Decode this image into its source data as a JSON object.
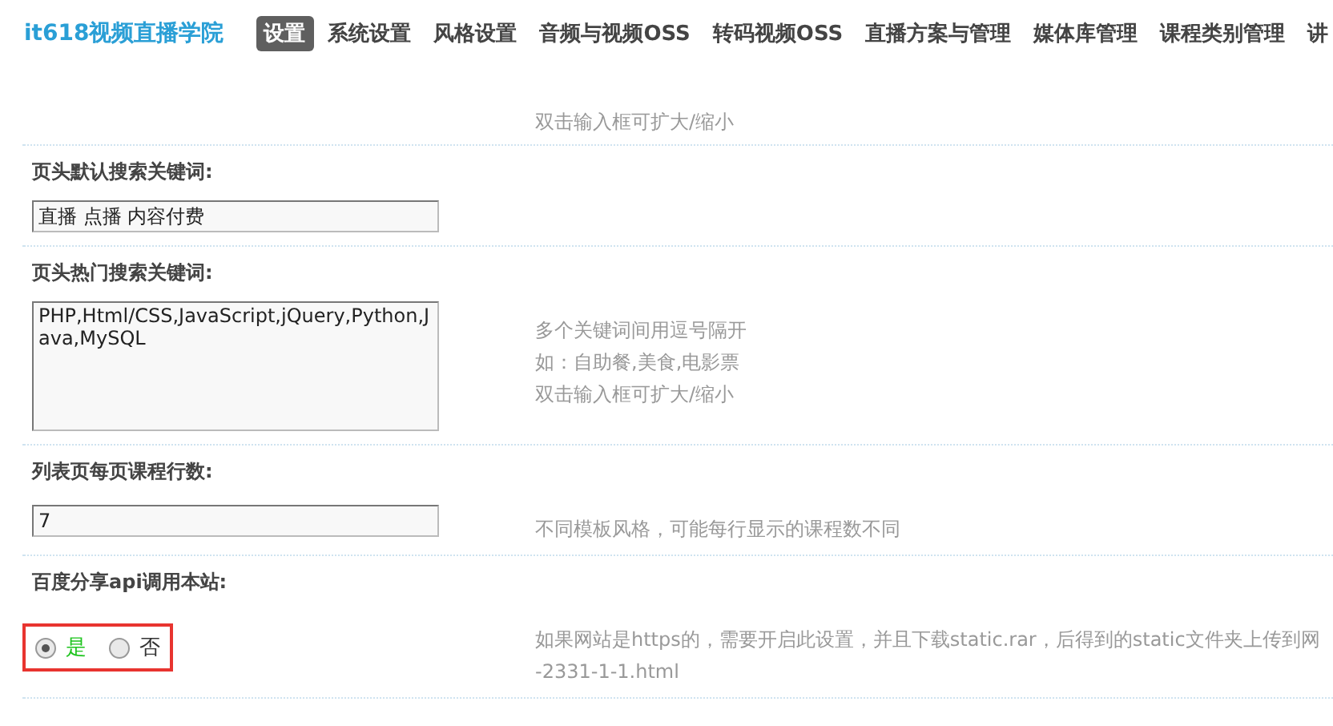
{
  "site_title": "it618视频直播学院",
  "nav": [
    {
      "label": "设置",
      "selected": true
    },
    {
      "label": "系统设置",
      "selected": false
    },
    {
      "label": "风格设置",
      "selected": false
    },
    {
      "label": "音频与视频OSS",
      "selected": false
    },
    {
      "label": "转码视频OSS",
      "selected": false
    },
    {
      "label": "直播方案与管理",
      "selected": false
    },
    {
      "label": "媒体库管理",
      "selected": false
    },
    {
      "label": "课程类别管理",
      "selected": false
    },
    {
      "label": "讲",
      "selected": false
    }
  ],
  "settings": [
    {
      "kind": "hint_only",
      "hints": [
        "双击输入框可扩大/缩小"
      ]
    },
    {
      "kind": "text",
      "label": "页头默认搜索关键词:",
      "value": "直播 点播 内容付费"
    },
    {
      "kind": "textarea",
      "label": "页头热门搜索关键词:",
      "value": "PHP,Html/CSS,JavaScript,jQuery,Python,Java,MySQL",
      "hints": [
        "多个关键词间用逗号隔开",
        "如：自助餐,美食,电影票",
        "双击输入框可扩大/缩小"
      ]
    },
    {
      "kind": "text",
      "label": "列表页每页课程行数:",
      "value": "7",
      "hints": [
        "不同模板风格，可能每行显示的课程数不同"
      ]
    },
    {
      "kind": "radio",
      "label": "百度分享api调用本站:",
      "highlighted": true,
      "options": [
        {
          "label": "是",
          "selected": true
        },
        {
          "label": "否",
          "selected": false
        }
      ],
      "hints": [
        "如果网站是https的，需要开启此设置，并且下载static.rar，后得到的static文件夹上传到网",
        "-2331-1-1.html"
      ]
    }
  ]
}
